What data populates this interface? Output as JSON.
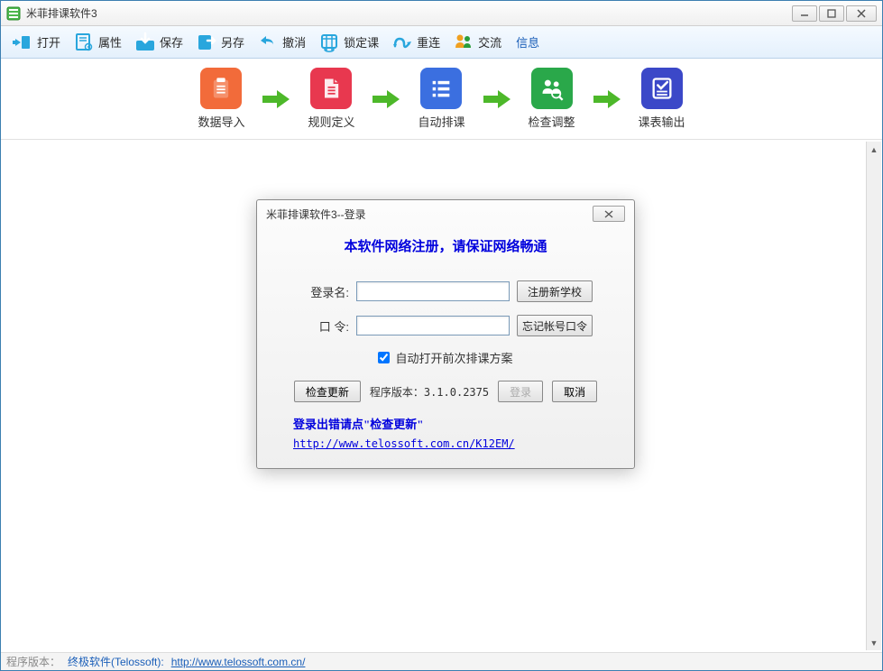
{
  "window": {
    "title": "米菲排课软件3"
  },
  "toolbar": {
    "open": "打开",
    "props": "属性",
    "save": "保存",
    "saveas": "另存",
    "undo": "撤消",
    "lock": "锁定课",
    "reconnect": "重连",
    "chat": "交流",
    "info": "信息"
  },
  "workflow": {
    "step1": "数据导入",
    "step2": "规则定义",
    "step3": "自动排课",
    "step4": "检查调整",
    "step5": "课表输出"
  },
  "dialog": {
    "title": "米菲排课软件3--登录",
    "heading": "本软件网络注册，请保证网络畅通",
    "username_label": "登录名:",
    "username_value": "",
    "password_label": "口 令:",
    "password_value": "",
    "register_btn": "注册新学校",
    "forgot_btn": "忘记帐号口令",
    "checkbox_label": "自动打开前次排课方案",
    "checkbox_checked": true,
    "check_update_btn": "检查更新",
    "version_label": "程序版本：3.1.0.2375",
    "login_btn": "登录",
    "cancel_btn": "取消",
    "error_hint": "登录出错请点\"检查更新\"",
    "url": "http://www.telossoft.com.cn/K12EM/"
  },
  "statusbar": {
    "version_label": "程序版本：",
    "company": "终极软件(Telossoft):",
    "url": "http://www.telossoft.com.cn/"
  }
}
